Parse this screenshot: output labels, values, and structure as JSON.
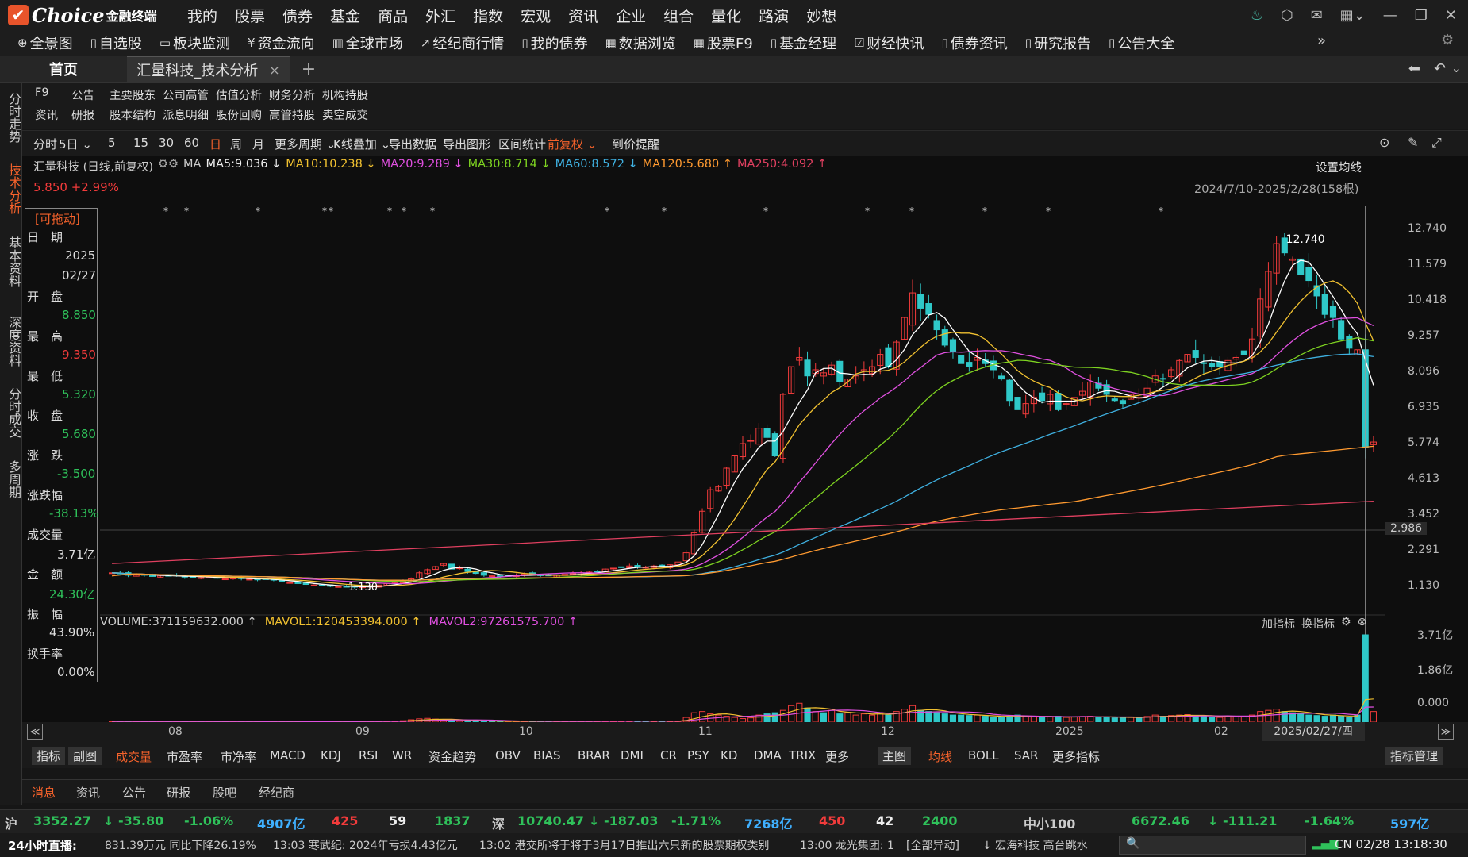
{
  "app": {
    "logo_text": "Choice",
    "logo_sub": "金融终端"
  },
  "menu": [
    "我的",
    "股票",
    "债券",
    "基金",
    "商品",
    "外汇",
    "指数",
    "宏观",
    "资讯",
    "企业",
    "组合",
    "量化",
    "路演",
    "妙想"
  ],
  "toolbar": [
    {
      "icon": "globe-icon",
      "label": "全景图"
    },
    {
      "icon": "doc-icon",
      "label": "自选股"
    },
    {
      "icon": "monitor-icon",
      "label": "板块监测"
    },
    {
      "icon": "money-icon",
      "label": "资金流向"
    },
    {
      "icon": "chart-icon",
      "label": "全球市场"
    },
    {
      "icon": "trend-icon",
      "label": "经纪商行情"
    },
    {
      "icon": "doc-icon",
      "label": "我的债券"
    },
    {
      "icon": "grid-icon",
      "label": "数据浏览"
    },
    {
      "icon": "grid-icon",
      "label": "股票F9"
    },
    {
      "icon": "doc-icon",
      "label": "基金经理"
    },
    {
      "icon": "news-icon",
      "label": "财经快讯"
    },
    {
      "icon": "doc-icon",
      "label": "债券资讯"
    },
    {
      "icon": "doc-icon",
      "label": "研究报告"
    },
    {
      "icon": "doc-icon",
      "label": "公告大全"
    }
  ],
  "tabs": {
    "home": "首页",
    "active": "汇量科技_技术分析",
    "close": "×",
    "add": "+"
  },
  "sidenav": [
    "分时走势",
    "技术分析",
    "基本资料",
    "深度资料",
    "分时成交",
    "多周期"
  ],
  "subnav": {
    "row1": [
      "F9",
      "公告",
      "主要股东",
      "公司高管",
      "估值分析",
      "财务分析",
      "机构持股"
    ],
    "row2": [
      "资讯",
      "研报",
      "股本结构",
      "派息明细",
      "股份回购",
      "高管持股",
      "卖空成交"
    ]
  },
  "periods": [
    "分时",
    "5日",
    "5",
    "15",
    "30",
    "60",
    "日",
    "周",
    "月",
    "更多周期",
    "K线叠加",
    "导出数据",
    "导出图形",
    "区间统计",
    "前复权",
    "到价提醒"
  ],
  "ma_header": {
    "stock": "汇量科技 (日线,前复权)",
    "ma": "MA",
    "ma5": "MA5:9.036 ↓",
    "ma10": "MA10:10.238 ↓",
    "ma20": "MA20:9.289 ↓",
    "ma30": "MA30:8.714 ↓",
    "ma60": "MA60:8.572 ↓",
    "ma120": "MA120:5.680 ↑",
    "ma250": "MA250:4.092 ↑",
    "set_ma": "设置均线"
  },
  "price_change": "5.850 +2.99%",
  "range": "2024/7/10-2025/2/28(158根)",
  "info": {
    "drag": "[可拖动]",
    "date_label": "日　期",
    "year": "2025",
    "date": "02/27",
    "open_label": "开　盘",
    "open": "8.850",
    "high_label": "最　高",
    "high": "9.350",
    "low_label": "最　低",
    "low": "5.320",
    "close_label": "收　盘",
    "close": "5.680",
    "chg_label": "涨　跌",
    "chg": "-3.500",
    "pct_label": "涨跌幅",
    "pct": "-38.13%",
    "vol_label": "成交量",
    "vol": "3.71亿",
    "amt_label": "金　额",
    "amt": "24.30亿",
    "amp_label": "振　幅",
    "amp": "43.90%",
    "turn_label": "换手率",
    "turn": "0.00%"
  },
  "price_axis": [
    "12.740",
    "11.579",
    "10.418",
    "9.257",
    "8.096",
    "6.935",
    "5.774",
    "4.613",
    "3.452",
    "2.986",
    "2.291",
    "1.130"
  ],
  "annot": {
    "high": "12.740",
    "low": "1.130"
  },
  "volume_header": {
    "vol": "VOLUME:371159632.000 ↑",
    "mavol1": "MAVOL1:120453394.000 ↑",
    "mavol2": "MAVOL2:97261575.700 ↑",
    "add": "加指标",
    "switch": "换指标"
  },
  "vol_axis": [
    "3.71亿",
    "1.86亿",
    "0.000"
  ],
  "months": [
    "08",
    "09",
    "10",
    "11",
    "12",
    "2025",
    "02"
  ],
  "cursor_date": "2025/02/27/四",
  "indicators": [
    "指标",
    "副图",
    "成交量",
    "市盈率",
    "市净率",
    "MACD",
    "KDJ",
    "RSI",
    "WR",
    "资金趋势",
    "OBV",
    "BIAS",
    "BRAR",
    "DMI",
    "CR",
    "PSY",
    "KD",
    "DMA",
    "TRIX",
    "更多",
    "主图",
    "均线",
    "BOLL",
    "SAR",
    "更多指标",
    "指标管理"
  ],
  "bottom_tabs": [
    "消息",
    "资讯",
    "公告",
    "研报",
    "股吧",
    "经纪商"
  ],
  "ticker": {
    "sh": "沪",
    "sh_idx": "3352.27",
    "sh_chg": "↓ -35.80",
    "sh_pct": "-1.06%",
    "sh_amt": "4907亿",
    "sh_up": "425",
    "sh_flat": "59",
    "sh_down": "1837",
    "sz": "深",
    "sz_idx": "10740.47",
    "sz_chg": "↓ -187.03",
    "sz_pct": "-1.71%",
    "sz_amt": "7268亿",
    "sz_up": "450",
    "sz_flat": "42",
    "sz_down": "2400",
    "zx": "中小100",
    "zx_idx": "6672.46",
    "zx_chg": "↓ -111.21",
    "zx_pct": "-1.64%",
    "zx_amt": "597亿"
  },
  "news": {
    "live": "24小时直播:",
    "n1": "831.39万元 同比下降26.19%",
    "n2": "13:03 寒武纪: 2024年亏损4.43亿元",
    "n3": "13:02 港交所将于将于3月17日推出六只新的股票期权类别",
    "n4": "13:00 龙光集团: 1",
    "alert": "[全部异动]",
    "hot": "↓ 宏海科技 高台跳水",
    "clock": "CN 02/28 13:18:30"
  },
  "colors": {
    "up": "#f23b3b",
    "down": "#2fc8c8",
    "ma5": "#ffffff",
    "ma10": "#f0c030",
    "ma20": "#e050e0",
    "ma30": "#7ed321",
    "ma60": "#3fb0e0",
    "ma120": "#ff9a30",
    "ma250": "#e04060"
  },
  "chart_data": {
    "type": "candlestick",
    "close": [
      1.6,
      1.58,
      1.52,
      1.55,
      1.52,
      1.48,
      1.51,
      1.49,
      1.5,
      1.46,
      1.47,
      1.44,
      1.46,
      1.42,
      1.4,
      1.43,
      1.41,
      1.39,
      1.37,
      1.4,
      1.36,
      1.3,
      1.28,
      1.25,
      1.22,
      1.2,
      1.18,
      1.16,
      1.15,
      1.14,
      1.13,
      1.14,
      1.16,
      1.2,
      1.25,
      1.3,
      1.33,
      1.4,
      1.6,
      1.7,
      1.8,
      1.9,
      1.72,
      1.76,
      1.64,
      1.58,
      1.52,
      1.5,
      1.48,
      1.5,
      1.52,
      1.56,
      1.55,
      1.52,
      1.5,
      1.52,
      1.55,
      1.58,
      1.6,
      1.62,
      1.65,
      1.72,
      1.75,
      1.78,
      1.82,
      1.8,
      1.78,
      1.82,
      1.8,
      1.86,
      1.95,
      2.25,
      2.9,
      3.6,
      4.3,
      4.4,
      5.0,
      5.4,
      5.8,
      5.9,
      6.3,
      6.0,
      5.4,
      7.4,
      8.3,
      8.6,
      8.0,
      8.2,
      8.1,
      8.35,
      7.8,
      7.9,
      8.0,
      8.2,
      8.3,
      8.7,
      8.3,
      9.1,
      9.9,
      10.7,
      10.2,
      10.0,
      9.5,
      9.0,
      8.8,
      8.4,
      8.3,
      8.6,
      8.4,
      8.2,
      7.9,
      7.2,
      6.9,
      7.1,
      7.3,
      7.2,
      7.4,
      6.9,
      7.1,
      7.3,
      7.5,
      7.8,
      7.6,
      7.4,
      7.2,
      7.1,
      7.4,
      7.3,
      7.6,
      8.0,
      7.9,
      8.2,
      8.5,
      8.7,
      8.6,
      8.4,
      8.3,
      8.3,
      8.5,
      8.6,
      8.7,
      9.2,
      10.5,
      11.4,
      12.3,
      12.0,
      11.8,
      11.3,
      11.1,
      10.6,
      10.0,
      9.9,
      9.2,
      8.9,
      8.85,
      5.68,
      5.85
    ],
    "volume": [
      0.03,
      0.02,
      0.03,
      0.02,
      0.02,
      0.03,
      0.02,
      0.02,
      0.02,
      0.03,
      0.02,
      0.02,
      0.02,
      0.02,
      0.03,
      0.02,
      0.02,
      0.02,
      0.02,
      0.02,
      0.03,
      0.02,
      0.02,
      0.02,
      0.02,
      0.02,
      0.02,
      0.02,
      0.03,
      0.02,
      0.02,
      0.03,
      0.03,
      0.04,
      0.05,
      0.05,
      0.06,
      0.1,
      0.14,
      0.16,
      0.13,
      0.1,
      0.08,
      0.06,
      0.05,
      0.05,
      0.04,
      0.04,
      0.03,
      0.03,
      0.03,
      0.04,
      0.03,
      0.03,
      0.03,
      0.03,
      0.03,
      0.04,
      0.03,
      0.03,
      0.04,
      0.05,
      0.05,
      0.04,
      0.04,
      0.04,
      0.03,
      0.04,
      0.03,
      0.04,
      0.05,
      0.2,
      0.4,
      0.45,
      0.35,
      0.3,
      0.25,
      0.2,
      0.15,
      0.18,
      0.3,
      0.35,
      0.4,
      0.5,
      0.7,
      0.8,
      0.6,
      0.45,
      0.4,
      0.5,
      0.35,
      0.4,
      0.3,
      0.35,
      0.3,
      0.4,
      0.3,
      0.45,
      0.55,
      0.7,
      0.5,
      0.45,
      0.4,
      0.35,
      0.3,
      0.3,
      0.28,
      0.3,
      0.25,
      0.22,
      0.2,
      0.25,
      0.3,
      0.25,
      0.22,
      0.2,
      0.22,
      0.25,
      0.2,
      0.22,
      0.24,
      0.25,
      0.22,
      0.2,
      0.18,
      0.2,
      0.22,
      0.2,
      0.24,
      0.3,
      0.25,
      0.28,
      0.3,
      0.32,
      0.28,
      0.25,
      0.22,
      0.2,
      0.25,
      0.22,
      0.24,
      0.3,
      0.45,
      0.5,
      0.55,
      0.45,
      0.4,
      0.35,
      0.3,
      0.28,
      0.25,
      0.3,
      0.25,
      0.22,
      0.3,
      3.71,
      0.45
    ],
    "ylim": [
      1.13,
      12.74
    ],
    "vol_max": 3.71
  }
}
